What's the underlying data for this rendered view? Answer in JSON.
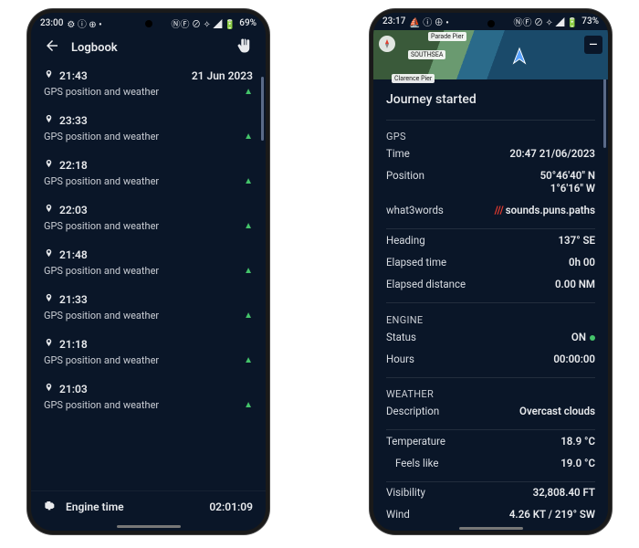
{
  "left": {
    "status": {
      "time": "23:00",
      "icons_l": "⚙ ⓘ ⊕ •",
      "icons_r": "ⓃⒻ ⊘ ✧ ◢ 🔋",
      "battery": "69%"
    },
    "title": "Logbook",
    "entries": [
      {
        "time": "21:43",
        "date": "21 Jun 2023",
        "desc": "GPS position and weather"
      },
      {
        "time": "23:33",
        "date": "",
        "desc": "GPS position and weather"
      },
      {
        "time": "22:18",
        "date": "",
        "desc": "GPS position and weather"
      },
      {
        "time": "22:03",
        "date": "",
        "desc": "GPS position and weather"
      },
      {
        "time": "21:48",
        "date": "",
        "desc": "GPS position and weather"
      },
      {
        "time": "21:33",
        "date": "",
        "desc": "GPS position and weather"
      },
      {
        "time": "21:18",
        "date": "",
        "desc": "GPS position and weather"
      },
      {
        "time": "21:03",
        "date": "",
        "desc": "GPS position and weather"
      }
    ],
    "footer_label": "Engine time",
    "footer_value": "02:01:09"
  },
  "right": {
    "status": {
      "time": "23:17",
      "icons_l": "⛵ ⓘ ⊕ •",
      "icons_r": "ⓃⒻ ⊘ ✧ ◢ 🔋",
      "battery": "73%"
    },
    "map_labels": {
      "a": "Parade Pier",
      "b": "SOUTHSEA",
      "c": "Clarence Pier"
    },
    "title": "Journey started",
    "gps": {
      "h": "GPS",
      "time_k": "Time",
      "time_v": "20:47 21/06/2023",
      "pos_k": "Position",
      "pos_v1": "50°46'40\" N",
      "pos_v2": "1°6'16\" W",
      "w3w_k": "what3words",
      "w3w_v": "sounds.puns.paths",
      "head_k": "Heading",
      "head_v": "137° SE",
      "elt_k": "Elapsed time",
      "elt_v": "0h 00",
      "eld_k": "Elapsed distance",
      "eld_v": "0.00 NM"
    },
    "engine": {
      "h": "ENGINE",
      "status_k": "Status",
      "status_v": "ON",
      "hours_k": "Hours",
      "hours_v": "00:00:00"
    },
    "weather": {
      "h": "WEATHER",
      "desc_k": "Description",
      "desc_v": "Overcast clouds",
      "temp_k": "Temperature",
      "temp_v": "18.9 °C",
      "feels_k": "Feels like",
      "feels_v": "19.0 °C",
      "vis_k": "Visibility",
      "vis_v": "32,808.40 FT",
      "wind_k": "Wind",
      "wind_v": "4.26 KT / 219° SW"
    }
  }
}
